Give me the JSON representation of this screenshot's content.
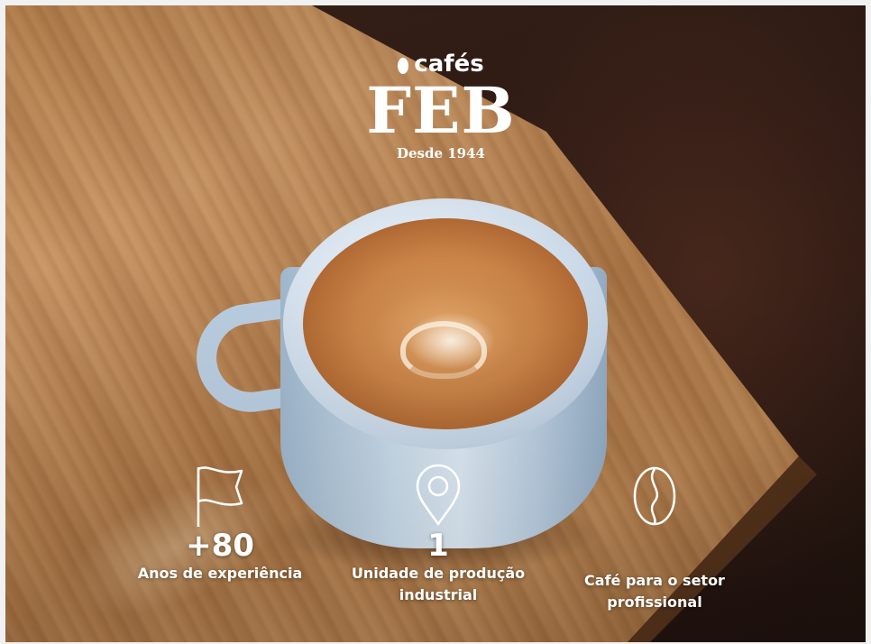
{
  "brand": {
    "small": "cafés",
    "name": "FEB",
    "since": "Desde 1944"
  },
  "stats": [
    {
      "icon": "flag-icon",
      "value": "+80",
      "label": "Anos de experiência"
    },
    {
      "icon": "location-pin-icon",
      "value": "1",
      "label": "Unidade de produção industrial"
    },
    {
      "icon": "coffee-bean-icon",
      "value": "",
      "label": "Café para o setor profissional"
    }
  ]
}
